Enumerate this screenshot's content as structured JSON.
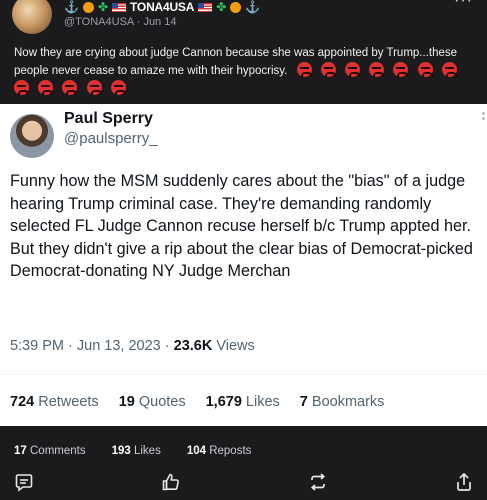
{
  "outer_post": {
    "display_name": "TONA4USA",
    "handle": "@TONA4USA",
    "time": "· Jun 14",
    "more_label": "···",
    "text": "Now they are crying about judge Cannon because she was appointed by Trump...these people never cease to amaze me with their hypocrisy.",
    "reaction_emoji": "angry-face-emoji",
    "reaction_count_shown": 12
  },
  "tweet": {
    "name": "Paul Sperry",
    "handle": "@paulsperry_",
    "body": "Funny how the MSM suddenly cares about the \"bias\" of a judge hearing Trump criminal case. They're demanding randomly selected FL Judge Cannon recuse herself b/c Trump appted her. But they didn't give a rip about the clear bias of Democrat-picked Democrat-donating NY Judge Merchan",
    "time": "5:39 PM · Jun 13, 2023 · ",
    "views_value": "23.6K",
    "views_label": " Views",
    "stats": [
      {
        "value": "724",
        "label": " Retweets"
      },
      {
        "value": "19",
        "label": " Quotes"
      },
      {
        "value": "1,679",
        "label": " Likes"
      },
      {
        "value": "7",
        "label": " Bookmarks"
      }
    ]
  },
  "footer": {
    "counts": [
      {
        "value": "17",
        "label": " Comments"
      },
      {
        "value": "193",
        "label": " Likes"
      },
      {
        "value": "104",
        "label": " Reposts"
      }
    ],
    "icons": [
      "comment-icon",
      "like-icon",
      "repost-icon",
      "share-icon"
    ]
  },
  "colors": {
    "dark_bg": "#1b1b1d",
    "tweet_bg": "#ffffff",
    "text_secondary": "#536471",
    "angry_red": "#e03131"
  }
}
